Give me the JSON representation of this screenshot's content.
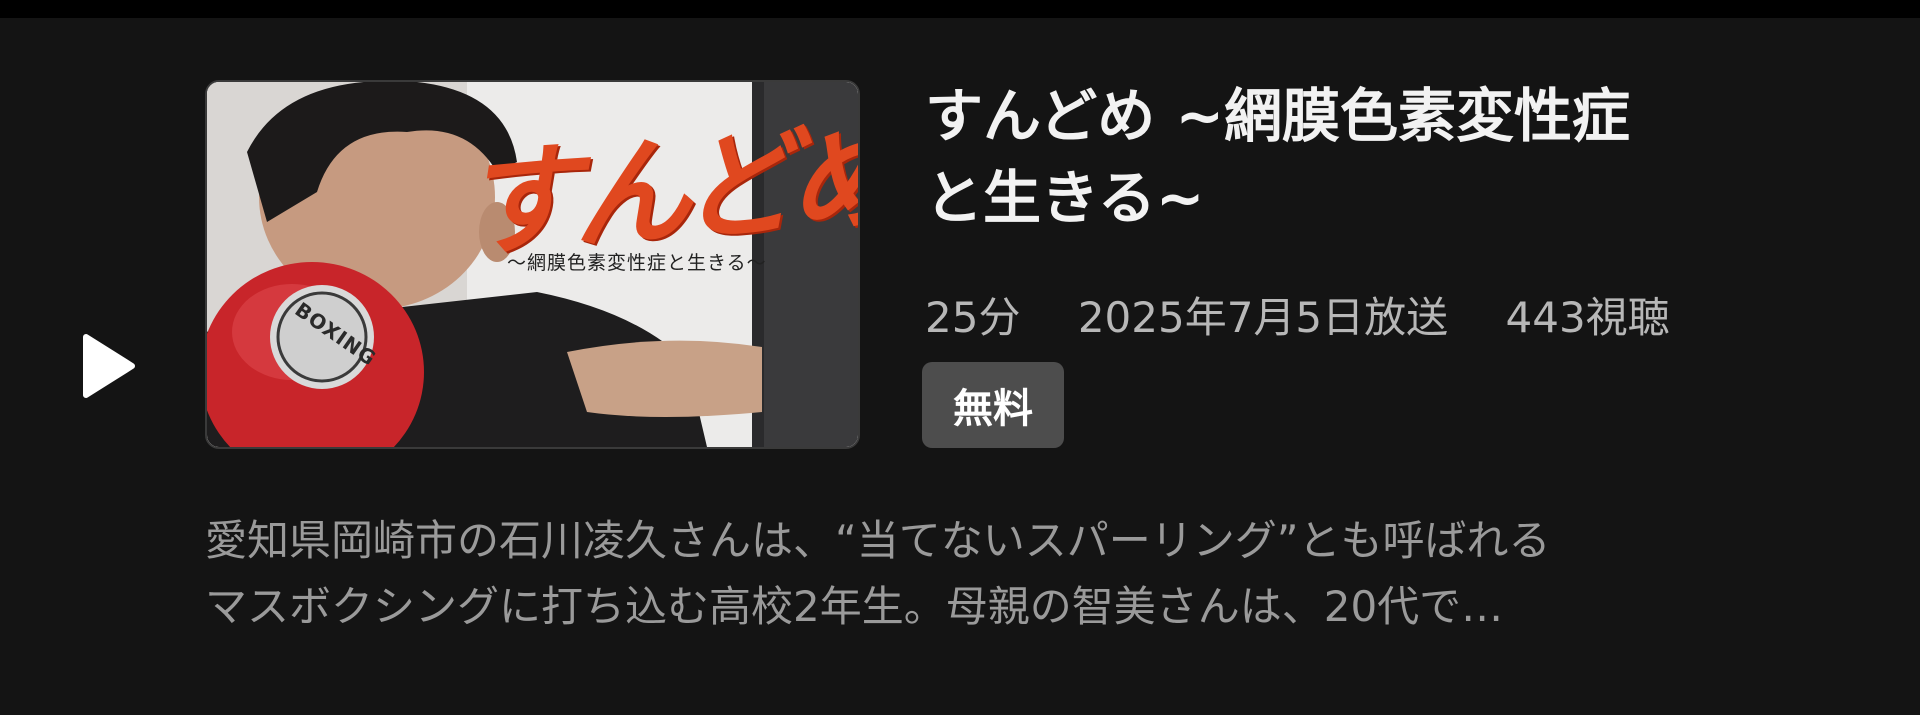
{
  "episode": {
    "thumbnail": {
      "logo_text": "すんどめ",
      "subtitle_text": "〜網膜色素変性症と生きる〜",
      "glove_text": "BOXING"
    },
    "title_line1": "すんどめ ~網膜色素変性症",
    "title_line2": "と生きる~",
    "duration": "25分",
    "broadcast_date": "2025年7月5日放送",
    "view_count": "443視聴",
    "badge": "無料",
    "description_line1": "愛知県岡崎市の石川凌久さんは、“当てないスパーリング”とも呼ばれる",
    "description_line2": "マスボクシングに打ち込む高校2年生。母親の智美さんは、20代で…"
  },
  "icons": {
    "play": "play-icon"
  },
  "colors": {
    "background": "#141414",
    "title": "#f2f2f2",
    "meta": "#b7b7b7",
    "description": "#9a9a9a",
    "badge_bg": "#4d4d4d",
    "logo_red": "#e0481f"
  }
}
